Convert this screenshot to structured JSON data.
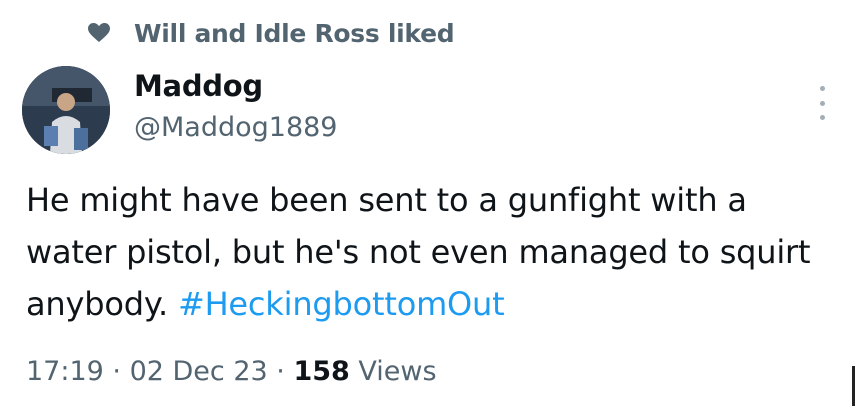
{
  "social_context": {
    "icon": "heart-icon",
    "text": "Will and Idle Ross liked"
  },
  "author": {
    "display_name": "Maddog",
    "handle": "@Maddog1889",
    "avatar_icon": "avatar"
  },
  "more_menu": {
    "icon": "more-vertical-icon"
  },
  "tweet": {
    "text": "He might have been sent to a gunfight with a water pistol, but he's not even managed to squirt anybody. ",
    "hashtag": "#HeckingbottomOut"
  },
  "meta": {
    "time": "17:19",
    "separator_1": " · ",
    "date": "02 Dec 23",
    "separator_2": " · ",
    "views_count": "158",
    "views_label": " Views"
  },
  "colors": {
    "text": "#0f1419",
    "secondary": "#536471",
    "link": "#1d9bf0"
  }
}
